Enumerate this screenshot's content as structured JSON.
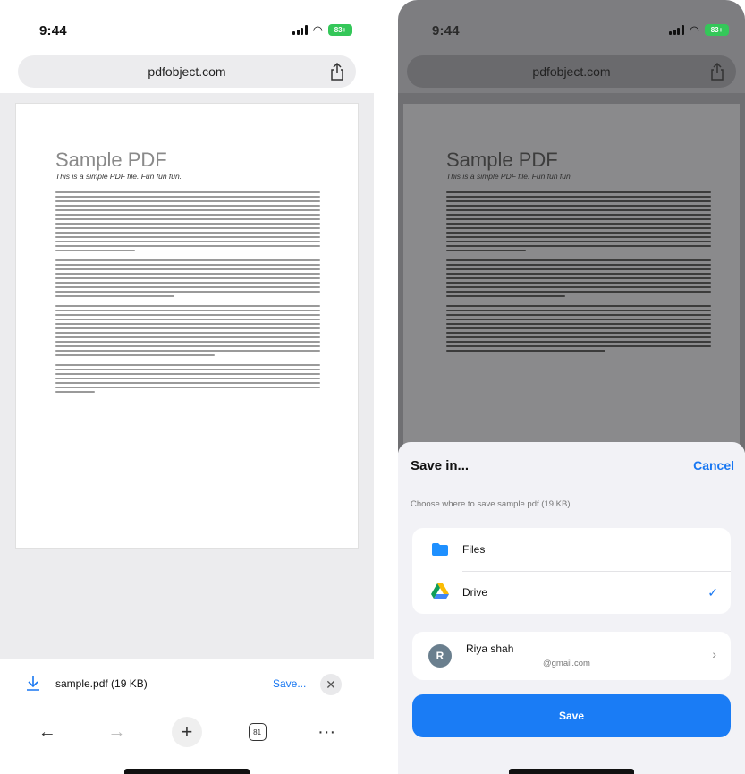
{
  "status": {
    "time": "9:44",
    "battery": "83+"
  },
  "browser": {
    "url": "pdfobject.com"
  },
  "document": {
    "title": "Sample PDF",
    "subtitle": "This is a simple PDF file. Fun fun fun."
  },
  "download_bar": {
    "filename": "sample.pdf (19 KB)",
    "save_label": "Save...",
    "close_glyph": "✕"
  },
  "toolbar": {
    "back": "←",
    "forward": "→",
    "new_tab": "+",
    "tab_count": "81",
    "more": "···"
  },
  "save_sheet": {
    "title": "Save in...",
    "cancel_label": "Cancel",
    "description": "Choose where to save sample.pdf (19 KB)",
    "locations": [
      {
        "label": "Files",
        "icon": "folder-icon",
        "selected": false
      },
      {
        "label": "Drive",
        "icon": "google-drive-icon",
        "selected": true
      }
    ],
    "checkmark": "✓",
    "account": {
      "initial": "R",
      "name": "Riya shah",
      "email": "@gmail.com",
      "chevron": "›"
    },
    "save_label": "Save"
  },
  "colors": {
    "accent": "#1877f2",
    "battery": "#34c759",
    "save_button": "#1a7cf5"
  }
}
